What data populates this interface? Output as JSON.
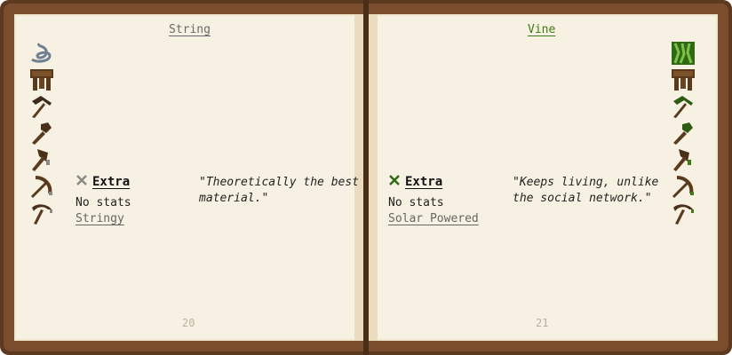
{
  "left_page": {
    "title": "String",
    "modifier": {
      "icon": "cross-icon",
      "label": "Extra"
    },
    "stats": "No stats",
    "trait": "Stringy",
    "quote": "\"Theoretically the best material.\"",
    "page_number": "20",
    "part_icons": [
      "string-icon",
      "tool-rod-icon",
      "pickaxe-head-icon",
      "hammer-head-icon",
      "axe-head-icon",
      "bow-limb-icon",
      "scythe-blade-icon"
    ],
    "material_color": "#8a8a8a"
  },
  "right_page": {
    "title": "Vine",
    "modifier": {
      "icon": "cross-icon",
      "label": "Extra"
    },
    "stats": "No stats",
    "trait": "Solar Powered",
    "quote": "\"Keeps living, unlike the social network.\"",
    "page_number": "21",
    "part_icons": [
      "vine-icon",
      "tool-rod-icon",
      "pickaxe-head-icon",
      "hammer-head-icon",
      "axe-head-icon",
      "bow-limb-icon",
      "scythe-blade-icon"
    ],
    "material_color": "#3b7a16"
  }
}
